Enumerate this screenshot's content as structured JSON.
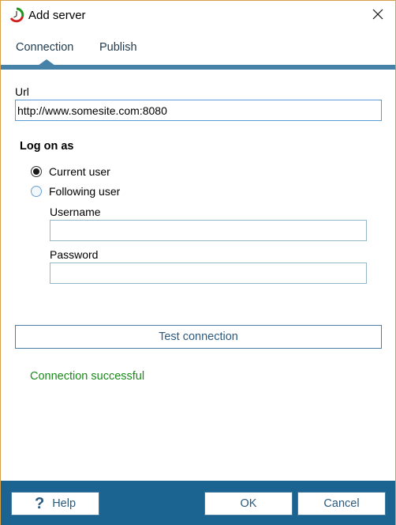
{
  "window": {
    "title": "Add server",
    "app_icon": "stopwatch-icon",
    "close_icon": "close-icon"
  },
  "tabs": [
    {
      "label": "Connection",
      "selected": true
    },
    {
      "label": "Publish",
      "selected": false
    }
  ],
  "connection": {
    "url_label": "Url",
    "url_value": "http://www.somesite.com:8080",
    "logon_header": "Log on as",
    "radio_options": [
      {
        "label": "Current user",
        "checked": true
      },
      {
        "label": "Following user",
        "checked": false
      }
    ],
    "username_label": "Username",
    "username_value": "",
    "password_label": "Password",
    "password_value": "",
    "test_button_label": "Test connection",
    "status_text": "Connection successful",
    "status_color": "#1a8a1a"
  },
  "footer": {
    "help_icon": "question-mark-icon",
    "help_label": "Help",
    "ok_label": "OK",
    "cancel_label": "Cancel"
  },
  "colors": {
    "accent": "#4681a8",
    "footer_bg": "#1b6491",
    "window_border": "#d9a04a"
  }
}
